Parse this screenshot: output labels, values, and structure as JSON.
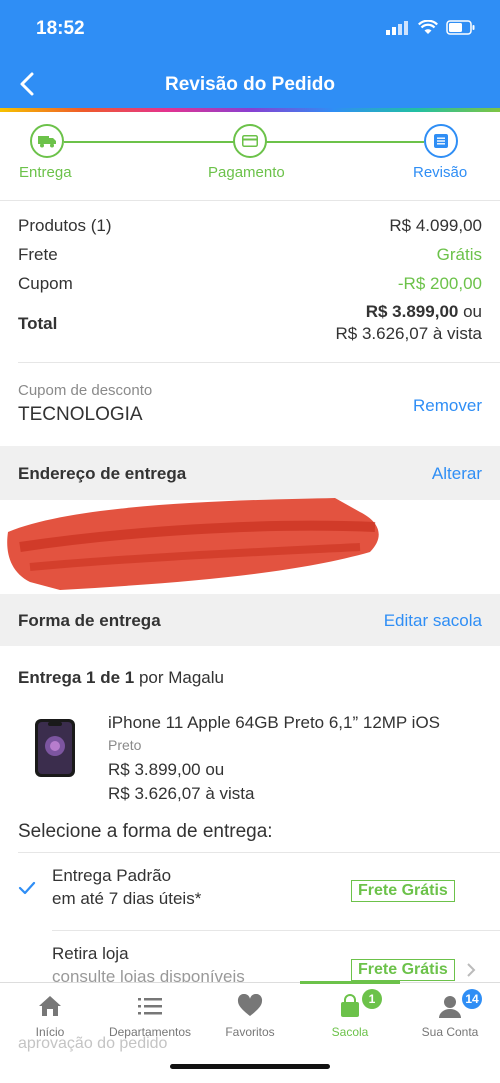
{
  "status": {
    "time": "18:52"
  },
  "header": {
    "title": "Revisão do Pedido"
  },
  "steps": [
    {
      "label": "Entrega"
    },
    {
      "label": "Pagamento"
    },
    {
      "label": "Revisão"
    }
  ],
  "summary": {
    "products_label": "Produtos (1)",
    "products_value": "R$ 4.099,00",
    "shipping_label": "Frete",
    "shipping_value": "Grátis",
    "coupon_label": "Cupom",
    "coupon_value": "-R$ 200,00",
    "total_label": "Total",
    "total_value": "R$ 3.899,00",
    "total_suffix": " ou",
    "total_cash": "R$ 3.626,07 à vista"
  },
  "discount": {
    "label": "Cupom de desconto",
    "code": "TECNOLOGIA",
    "remove": "Remover"
  },
  "address": {
    "title": "Endereço de entrega",
    "action": "Alterar"
  },
  "delivery": {
    "title": "Forma de entrega",
    "action": "Editar sacola",
    "shipment_bold": "Entrega 1 de 1",
    "shipment_rest": " por Magalu"
  },
  "product": {
    "name": "iPhone 11 Apple 64GB Preto 6,1” 12MP iOS",
    "color": "Preto",
    "price": "R$ 3.899,00 ou",
    "cash": "R$ 3.626,07 à vista"
  },
  "shipping_select": {
    "title": "Selecione a forma de entrega:",
    "options": [
      {
        "name": "Entrega Padrão",
        "detail": "em até 7 dias úteis*",
        "badge": "Frete Grátis"
      },
      {
        "name": "Retira loja",
        "detail": "consulte lojas disponíveis",
        "badge": "Frete Grátis"
      }
    ],
    "footnote": "aprovação do pedido"
  },
  "tabs": [
    {
      "label": "Início"
    },
    {
      "label": "Departamentos"
    },
    {
      "label": "Favoritos"
    },
    {
      "label": "Sacola",
      "count": "1"
    },
    {
      "label": "Sua Conta",
      "count": "14"
    }
  ],
  "colors": {
    "primary": "#2f8ef5",
    "success": "#6cc24a"
  }
}
